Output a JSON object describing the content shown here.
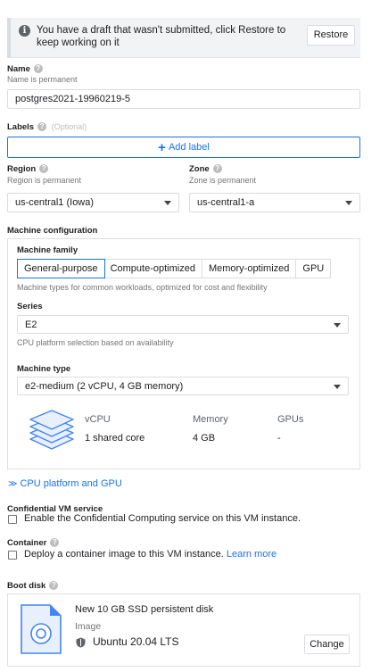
{
  "draft": {
    "message": "You have a draft that wasn't submitted, click Restore to keep working on it",
    "restore_label": "Restore",
    "icon": "info-icon"
  },
  "name": {
    "label": "Name",
    "hint": "Name is permanent",
    "value": "postgres2021-19960219-5"
  },
  "labels": {
    "label": "Labels",
    "optional": "(Optional)",
    "add_label": "Add label"
  },
  "region": {
    "label": "Region",
    "hint": "Region is permanent",
    "value": "us-central1 (Iowa)"
  },
  "zone": {
    "label": "Zone",
    "hint": "Zone is permanent",
    "value": "us-central1-a"
  },
  "machine": {
    "section_label": "Machine configuration",
    "family_label": "Machine family",
    "tabs": [
      "General-purpose",
      "Compute-optimized",
      "Memory-optimized",
      "GPU"
    ],
    "active_tab": "General-purpose",
    "family_desc": "Machine types for common workloads, optimized for cost and flexibility",
    "series_label": "Series",
    "series_value": "E2",
    "series_desc": "CPU platform selection based on availability",
    "type_label": "Machine type",
    "type_value": "e2-medium (2 vCPU, 4 GB memory)",
    "specs": {
      "headers": [
        "vCPU",
        "Memory",
        "GPUs"
      ],
      "values": [
        "1 shared core",
        "4 GB",
        "-"
      ]
    }
  },
  "cpu_platform_link": "CPU platform and GPU",
  "confidential": {
    "label": "Confidential VM service",
    "checkbox_text": "Enable the Confidential Computing service on this VM instance.",
    "checked": false
  },
  "container": {
    "label": "Container",
    "checkbox_text": "Deploy a container image to this VM instance.",
    "learn_more": "Learn more",
    "checked": false
  },
  "boot_disk": {
    "label": "Boot disk",
    "title": "New 10 GB SSD persistent disk",
    "image_label": "Image",
    "image_value": "Ubuntu 20.04 LTS",
    "change_label": "Change"
  },
  "colors": {
    "accent": "#1a73e8",
    "stack_fill": "#e8f0fe",
    "stack_stroke": "#4285f4"
  }
}
